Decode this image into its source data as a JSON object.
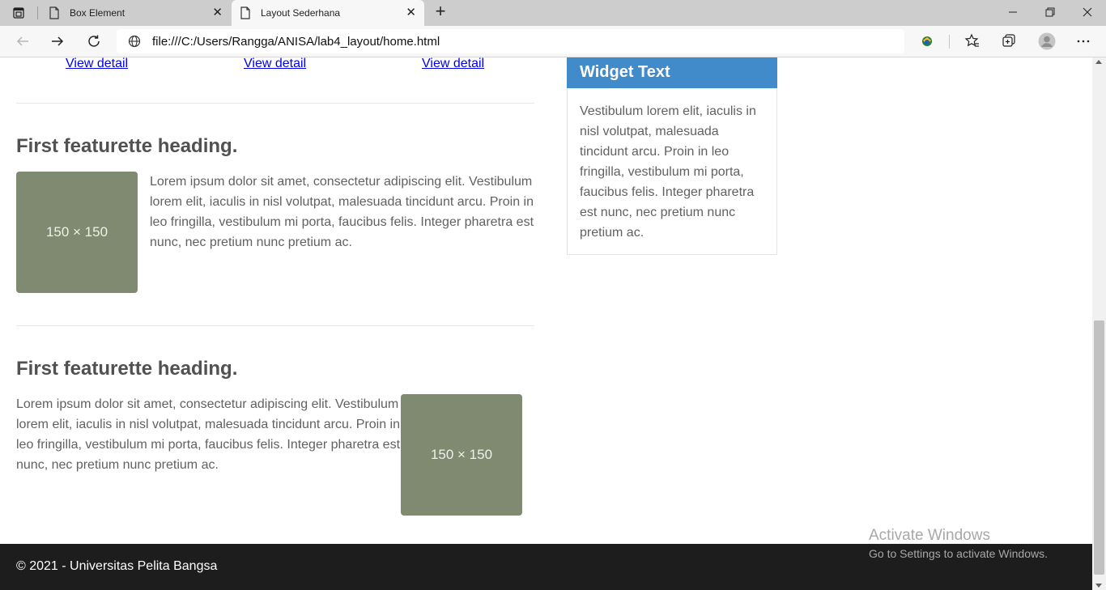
{
  "browser": {
    "tabs": [
      {
        "title": "Box Element"
      },
      {
        "title": "Layout Sederhana"
      }
    ],
    "url": "file:///C:/Users/Rangga/ANISA/lab4_layout/home.html",
    "icons": [
      "tab-actions-icon",
      "document-icon",
      "close-icon",
      "plus-icon",
      "minimize-icon",
      "restore-icon",
      "window-close-icon",
      "back-icon",
      "forward-icon",
      "refresh-icon",
      "globe-icon",
      "extension-icon",
      "favorites-icon",
      "collections-icon",
      "profile-icon",
      "more-icon"
    ]
  },
  "page": {
    "view_links": [
      "View detail",
      "View detail",
      "View detail"
    ],
    "featurettes": [
      {
        "heading": "First featurette heading.",
        "text": "Lorem ipsum dolor sit amet, consectetur adipiscing elit. Vestibulum lorem elit, iaculis in nisl volutpat, malesuada tincidunt arcu. Proin in leo fringilla, vestibulum mi porta, faucibus felis. Integer pharetra est nunc, nec pretium nunc pretium ac.",
        "image_label": "150 × 150"
      },
      {
        "heading": "First featurette heading.",
        "text": "Lorem ipsum dolor sit amet, consectetur adipiscing elit. Vestibulum lorem elit, iaculis in nisl volutpat, malesuada tincidunt arcu. Proin in leo fringilla, vestibulum mi porta, faucibus felis. Integer pharetra est nunc, nec pretium nunc pretium ac.",
        "image_label": "150 × 150"
      }
    ],
    "widget": {
      "title": "Widget Text",
      "body": "Vestibulum lorem elit, iaculis in nisl volutpat, malesuada tincidunt arcu. Proin in leo fringilla, vestibulum mi porta, faucibus felis. Integer pharetra est nunc, nec pretium nunc pretium ac."
    },
    "footer": "© 2021 - Universitas Pelita Bangsa"
  },
  "watermark": {
    "title": "Activate Windows",
    "subtitle": "Go to Settings to activate Windows."
  },
  "colors": {
    "widget_header": "#428bca",
    "placeholder": "#7f8a71",
    "footer": "#1d1d1d",
    "link": "#0000ee"
  }
}
